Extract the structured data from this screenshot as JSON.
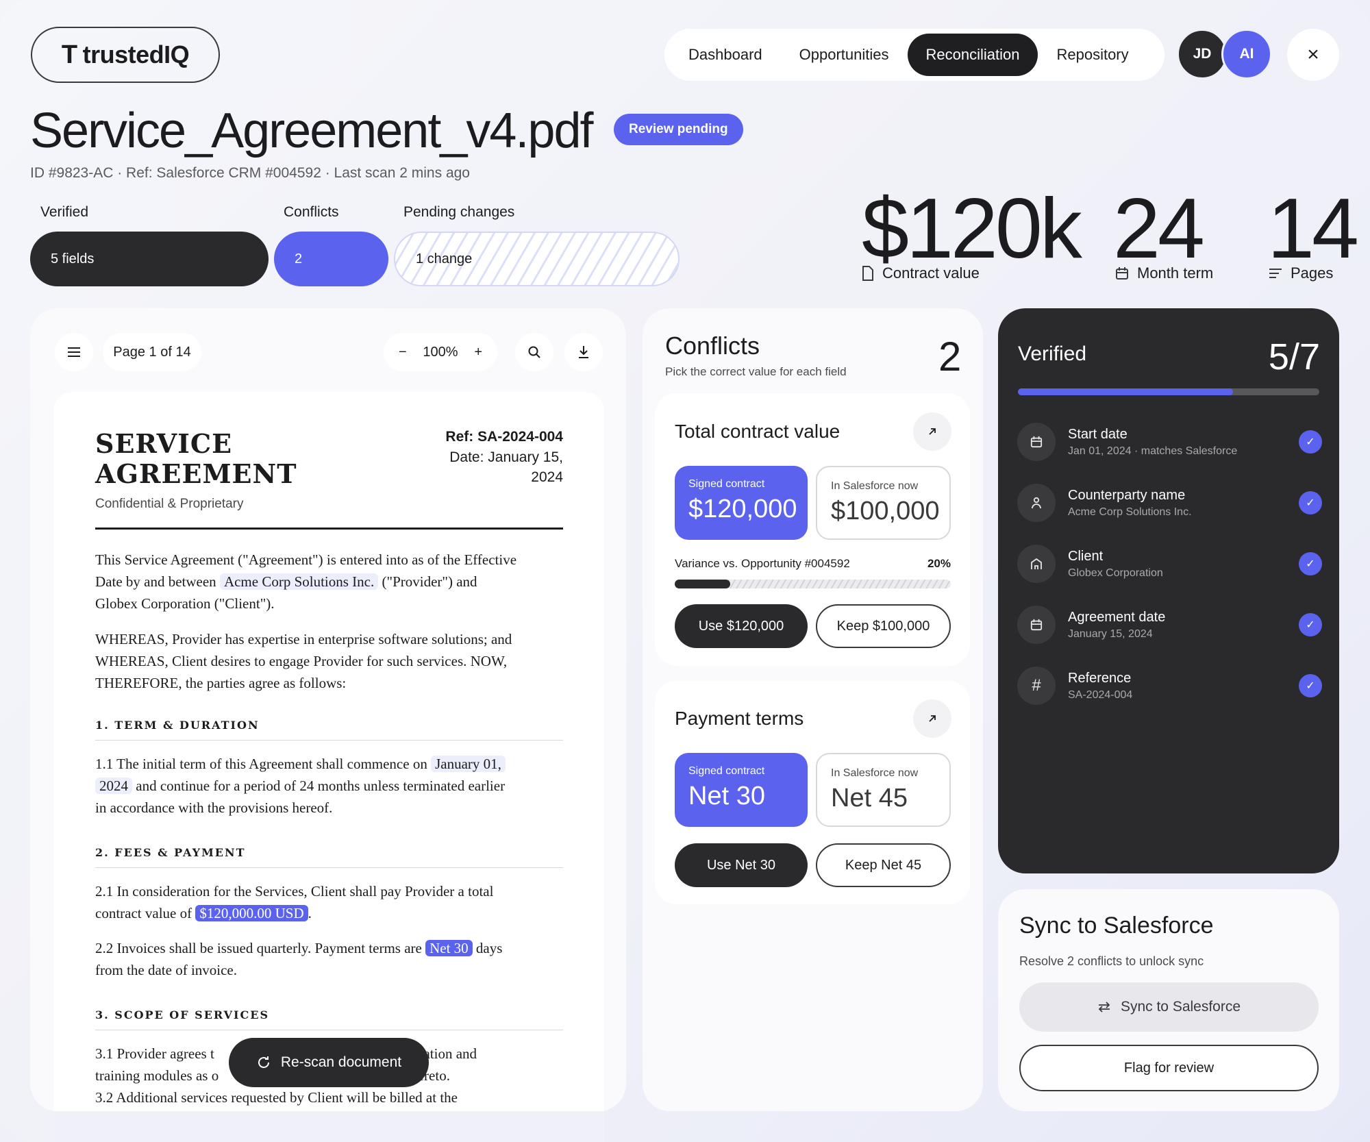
{
  "header": {
    "logo_mark": "T",
    "logo_text": "trustedIQ",
    "nav": [
      "Dashboard",
      "Opportunities",
      "Reconciliation",
      "Repository"
    ],
    "active_nav": "Reconciliation",
    "avatars": [
      "JD",
      "AI"
    ],
    "close_icon": "×"
  },
  "document": {
    "title": "Service_Agreement_v4.pdf",
    "badge": "Review pending",
    "subline": "ID #9823-AC · Ref: Salesforce CRM #004592 · Last scan 2 mins ago"
  },
  "summary": {
    "verified_label": "Verified",
    "verified_value": "5 fields",
    "conflicts_label": "Conflicts",
    "conflicts_value": "2",
    "pending_label": "Pending changes",
    "pending_value": "1 change"
  },
  "stats": [
    {
      "value": "$120k",
      "label": "Contract value",
      "icon": "document-icon"
    },
    {
      "value": "24",
      "label": "Month term",
      "icon": "calendar-icon"
    },
    {
      "value": "14",
      "label": "Pages",
      "icon": "lines-icon"
    }
  ],
  "viewer": {
    "page_label": "Page 1 of 14",
    "zoom": "100%",
    "minus": "−",
    "plus": "+",
    "rescan": "Re-scan document"
  },
  "agreement": {
    "heading_1": "SERVICE",
    "heading_2": "AGREEMENT",
    "tagline": "Confidential & Proprietary",
    "ref": "Ref: SA-2024-004",
    "date_1": "Date: January 15,",
    "date_2": "2024",
    "intro_a": "This Service Agreement (\"Agreement\") is entered into as of the Effective",
    "intro_b": "Date by and between",
    "intro_provider": "Acme Corp Solutions Inc.",
    "intro_c": "(\"Provider\") and",
    "intro_d": "Globex Corporation (\"Client\").",
    "whereas_1": "WHEREAS, Provider has expertise in enterprise software solutions; and",
    "whereas_2": "WHEREAS, Client desires to engage Provider for such services. NOW,",
    "whereas_3": "THEREFORE, the parties agree as follows:",
    "sec1": "1. TERM & DURATION",
    "s11_a": "1.1 The initial term of this Agreement shall commence on",
    "s11_date_a": "January 01,",
    "s11_date_b": "2024",
    "s11_b": "and continue for a period of 24 months unless terminated earlier",
    "s11_c": "in accordance with the provisions hereof.",
    "sec2": "2. FEES & PAYMENT",
    "s21_a": "2.1 In consideration for the Services, Client shall pay Provider a total",
    "s21_b": "contract value of",
    "s21_val": "$120,000.00 USD",
    "s21_end": ".",
    "s22_a": "2.2 Invoices shall be issued quarterly. Payment terms are",
    "s22_val": "Net 30",
    "s22_b": "days",
    "s22_c": "from the date of invoice.",
    "sec3": "3. SCOPE OF SERVICES",
    "s31_a": "3.1 Provider agrees t",
    "s31_a2": "entation and",
    "s31_b": "training modules as o",
    "s31_b2": "hereto.",
    "s32": "3.2 Additional services requested by Client will be billed at the"
  },
  "conflicts": {
    "title": "Conflicts",
    "subtitle": "Pick the correct value for each field",
    "count": "2",
    "items": [
      {
        "title": "Total contract value",
        "signed_label": "Signed contract",
        "signed_value": "$120,000",
        "sf_label": "In Salesforce now",
        "sf_value": "$100,000",
        "variance_label": "Variance vs. Opportunity #004592",
        "variance_pct": "20%",
        "variance": 0.2,
        "use_btn": "Use $120,000",
        "keep_btn": "Keep $100,000"
      },
      {
        "title": "Payment terms",
        "signed_label": "Signed contract",
        "signed_value": "Net 30",
        "sf_label": "In Salesforce now",
        "sf_value": "Net 45",
        "use_btn": "Use Net 30",
        "keep_btn": "Keep Net 45"
      }
    ]
  },
  "verified": {
    "title": "Verified",
    "count": "5/7",
    "progress": 0.714,
    "items": [
      {
        "name": "Start date",
        "sub": "Jan 01, 2024 · matches Salesforce",
        "icon": "calendar-icon"
      },
      {
        "name": "Counterparty name",
        "sub": "Acme Corp Solutions Inc.",
        "icon": "person-icon"
      },
      {
        "name": "Client",
        "sub": "Globex Corporation",
        "icon": "building-icon"
      },
      {
        "name": "Agreement date",
        "sub": "January 15, 2024",
        "icon": "calendar-icon"
      },
      {
        "name": "Reference",
        "sub": "SA-2024-004",
        "icon": "hash-icon"
      }
    ]
  },
  "sync": {
    "title": "Sync to Salesforce",
    "subtitle": "Resolve 2 conflicts to unlock sync",
    "sync_btn": "Sync to Salesforce",
    "flag_btn": "Flag for review"
  },
  "colors": {
    "accent": "#5b63ee",
    "dark": "#2a2a2c",
    "background": "#f2f3f9"
  }
}
